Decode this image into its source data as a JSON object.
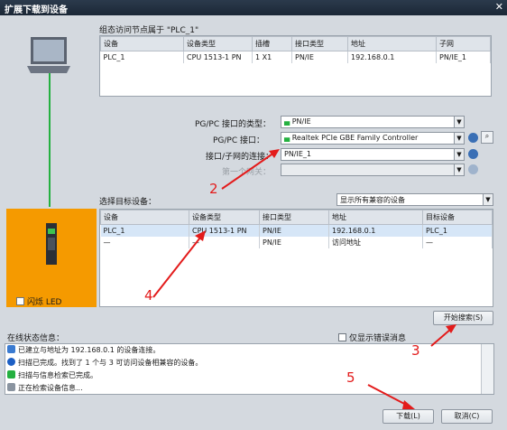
{
  "window": {
    "title": "扩展下载到设备",
    "close_glyph": "✕"
  },
  "config": {
    "heading": "组态访问节点属于 \"PLC_1\"",
    "columns": [
      "设备",
      "设备类型",
      "插槽",
      "接口类型",
      "地址",
      "子网"
    ],
    "row": [
      "PLC_1",
      "CPU 1513-1 PN",
      "1 X1",
      "PN/IE",
      "192.168.0.1",
      "PN/IE_1"
    ]
  },
  "form": {
    "pgpc_type_label": "PG/PC 接口的类型：",
    "pgpc_type_value": "PN/IE",
    "pgpc_iface_label": "PG/PC 接口：",
    "pgpc_iface_value": "Realtek PCIe GBE Family Controller",
    "subnet_conn_label": "接口/子网的连接：",
    "subnet_conn_value": "PN/IE_1",
    "first_gw_label": "第一个网关：",
    "first_gw_value": ""
  },
  "target": {
    "heading": "选择目标设备：",
    "filter_value": "显示所有兼容的设备",
    "columns": [
      "设备",
      "设备类型",
      "接口类型",
      "地址",
      "目标设备"
    ],
    "rows": [
      [
        "PLC_1",
        "CPU 1513-1 PN",
        "PN/IE",
        "192.168.0.1",
        "PLC_1"
      ],
      [
        "—",
        "—",
        "PN/IE",
        "访问地址",
        "—"
      ]
    ]
  },
  "device_panel": {
    "flash_label": "闪烁 LED"
  },
  "buttons": {
    "search": "开始搜索(S)",
    "download": "下载(L)",
    "cancel": "取消(C)"
  },
  "status": {
    "heading": "在线状态信息：",
    "errors_only_label": "仅显示错误消息",
    "lines": [
      "已建立与地址为 192.168.0.1 的设备连接。",
      "扫描已完成。找到了 1 个与 3 可访问设备相兼容的设备。",
      "扫描与信息检索已完成。",
      "正在检索设备信息..."
    ]
  },
  "annotations": [
    "2",
    "3",
    "4",
    "5"
  ],
  "colors": {
    "accent": "#f59a00",
    "annotation": "#e31b1b",
    "link": "#24b040"
  }
}
